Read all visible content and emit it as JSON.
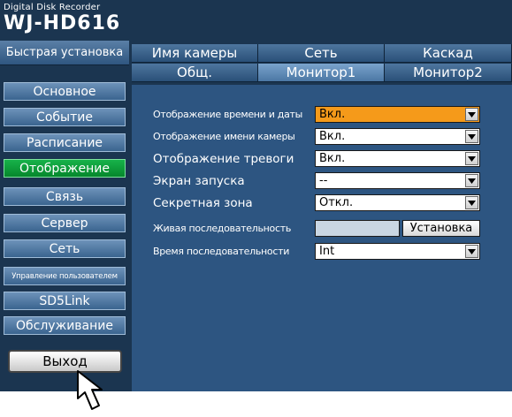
{
  "header": {
    "device_sub": "Digital Disk Recorder",
    "device_model": "WJ-HD616"
  },
  "quick_setup": "Быстрая установка",
  "sidebar": {
    "items": [
      {
        "label": "Основное"
      },
      {
        "label": "Событие"
      },
      {
        "label": "Расписание"
      },
      {
        "label": "Отображение",
        "active": true
      },
      {
        "label": "Связь"
      },
      {
        "label": "Сервер"
      },
      {
        "label": "Сеть"
      },
      {
        "label": "Управление пользователем"
      },
      {
        "label": "SD5Link"
      },
      {
        "label": "Обслуживание"
      }
    ],
    "logout_label": "Выход"
  },
  "tabs": {
    "row1": [
      {
        "label": "Имя камеры"
      },
      {
        "label": "Сеть"
      },
      {
        "label": "Каскад"
      }
    ],
    "row2": [
      {
        "label": "Общ."
      },
      {
        "label": "Монитор1",
        "active": true
      },
      {
        "label": "Монитор2"
      }
    ]
  },
  "form": {
    "rows": [
      {
        "label": "Отображение времени и даты",
        "value": "Вкл."
      },
      {
        "label": "Отображение имени камеры",
        "value": "Вкл."
      },
      {
        "label": "Отображение тревоги",
        "value": "Вкл."
      },
      {
        "label": "Экран запуска",
        "value": "--"
      },
      {
        "label": "Секретная зона",
        "value": "Откл."
      },
      {
        "label": "Живая последовательность",
        "button": "Установка"
      },
      {
        "label": "Время последовательности",
        "value": "Int"
      }
    ]
  },
  "colors": {
    "background": "#1b3550",
    "panel": "#2d5581",
    "active_nav": "#0b9b38",
    "highlight": "#f59a1a"
  },
  "icons": {
    "dropdown": "chevron-down-icon",
    "pointer": "arrow-cursor-icon"
  }
}
